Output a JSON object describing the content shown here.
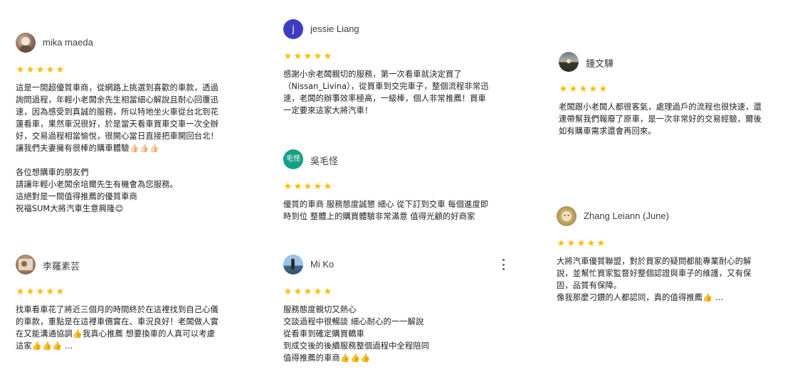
{
  "colors": {
    "star": "#fbbc04",
    "avatar_j": "#3f3dbf",
    "avatar_wu": "#16a085"
  },
  "reviews": [
    {
      "name": "mika maeda",
      "avatar_icon": "photo-avatar",
      "rating": 5,
      "lines": [
        "這是一間超優質車商，從網路上挑選到喜歡的車款，透過",
        "詢問過程，年輕小老闆余先生相當細心解說且耐心回覆迅",
        "速，因為感受到真誠的服務，所以特地坐火車從台北到花",
        "蓮看車，果然車況很好，於是當天看車買車交車一次全辦",
        "好，交易過程相當愉悅，很開心當日直接把車開回台北！",
        "讓我們夫妻擁有很棒的購車體驗👍🏻👍🏻👍🏻",
        "",
        "各位想購車的朋友們",
        "請讓年輕小老闆余培爾先生有機會為您服務。",
        "這絕對是一間值得推薦的優質車商",
        "祝福SUM大將汽車生意興隆😊"
      ]
    },
    {
      "name": "李羅素芸",
      "avatar_icon": "photo-avatar",
      "rating": 5,
      "lines": [
        "找車看車花了將近三個月的時間終於在這裡找到自己心儀",
        "的車款，重點是在這裡車價實在、車況良好！老闆做人實",
        "在又能溝通協調👍我真心推薦 想要換車的人真可以考慮",
        "這家👍👍👍 …"
      ]
    },
    {
      "name": "jessie Liang",
      "avatar_letter": "j",
      "rating": 5,
      "lines": [
        "感謝小余老闆親切的服務，第一次看車就決定買了",
        "（Nissan_Livina），從買車到交完車子，整個流程非常迅",
        "速，老闆的辦事效率極高，一級棒，個人非常推薦！買車",
        "一定要來這家大將汽車！"
      ]
    },
    {
      "name": "吳毛怪",
      "avatar_letter": "毛怪",
      "rating": 5,
      "lines": [
        "優質的車商 服務態度誠懇 細心 從下訂到交車 每個進度即",
        "時到位 整體上的購買體驗非常滿意 值得光顧的好商家"
      ]
    },
    {
      "name": "Mi Ko",
      "avatar_icon": "photo-avatar",
      "rating": 5,
      "lines": [
        "服務態度親切又熱心",
        "交談過程中很暢談 細心耐心的一一解說",
        "從看車到確定購買轎車",
        "到成交後的後續服務整個過程中全程陪同",
        "值得推薦的車商👍👍👍"
      ]
    },
    {
      "name": "鍾文驊",
      "avatar_icon": "photo-avatar",
      "rating": 5,
      "lines": [
        "老闆跟小老闆人都很客氣，處理過戶的流程也很快速，還",
        "連帶幫我們報廢了原車，是一次非常好的交易經驗，爾後",
        "如有購車需求還會再回來。"
      ]
    },
    {
      "name": "Zhang Leiann (June)",
      "avatar_icon": "photo-avatar",
      "rating": 5,
      "lines": [
        "大將汽車優質聯盟，對於買家的疑問都能專業耐心的解",
        "說，並幫忙買家監督好整個認證與車子的維護，又有保",
        "固，品質有保障。",
        "像我那麼刁鑽的人都認同，真的值得推薦👍 …"
      ]
    }
  ]
}
